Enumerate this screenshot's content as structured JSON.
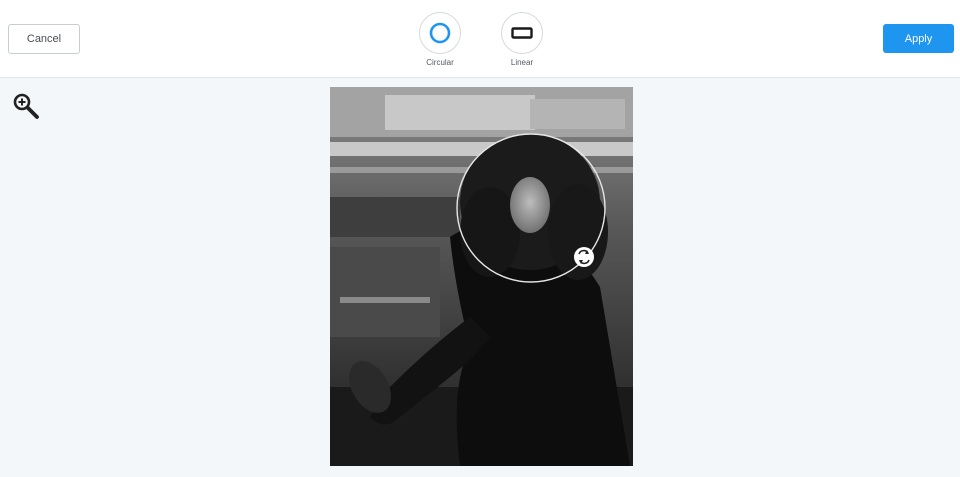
{
  "toolbar": {
    "cancel_label": "Cancel",
    "apply_label": "Apply",
    "modes": [
      {
        "label": "Circular",
        "icon": "circle-mask-icon",
        "selected": true
      },
      {
        "label": "Linear",
        "icon": "rectangle-mask-icon",
        "selected": false
      }
    ]
  },
  "tools": {
    "zoom_icon": "zoom-in-icon"
  },
  "canvas": {
    "image": "black-and-white-portrait-photo",
    "mask_type": "circular"
  },
  "colors": {
    "accent": "#1e96f0",
    "toolbar_bg": "#ffffff",
    "workspace_bg": "#f4f7f9"
  }
}
